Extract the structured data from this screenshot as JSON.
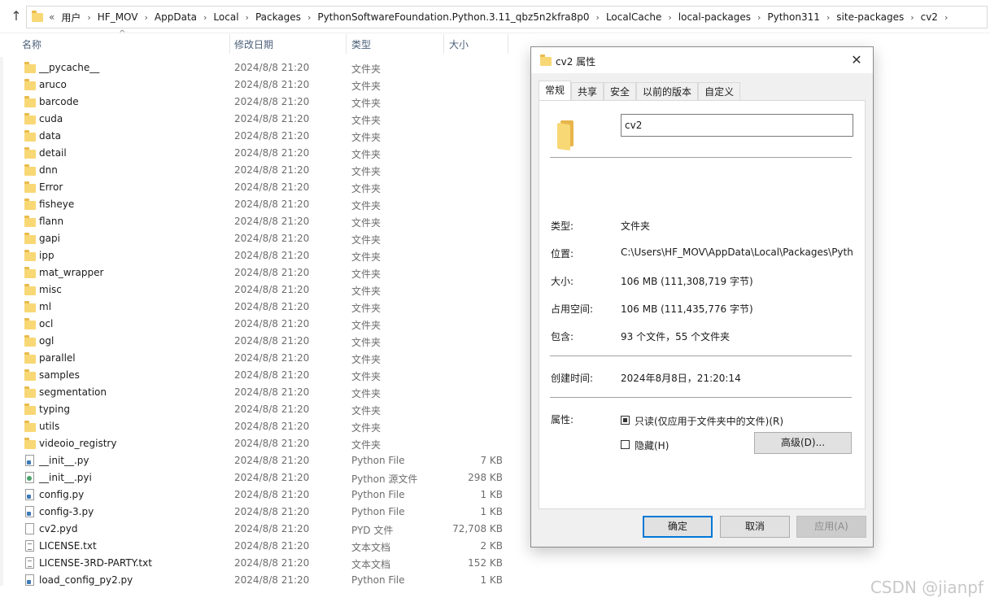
{
  "address_bar": {
    "overflow": "«",
    "crumbs": [
      "用户",
      "HF_MOV",
      "AppData",
      "Local",
      "Packages",
      "PythonSoftwareFoundation.Python.3.11_qbz5n2kfra8p0",
      "LocalCache",
      "local-packages",
      "Python311",
      "site-packages",
      "cv2"
    ]
  },
  "columns": {
    "name": "名称",
    "modified": "修改日期",
    "type": "类型",
    "size": "大小"
  },
  "files": [
    {
      "name": "__pycache__",
      "date": "2024/8/8 21:20",
      "type": "文件夹",
      "size": "",
      "icon": "folder"
    },
    {
      "name": "aruco",
      "date": "2024/8/8 21:20",
      "type": "文件夹",
      "size": "",
      "icon": "folder"
    },
    {
      "name": "barcode",
      "date": "2024/8/8 21:20",
      "type": "文件夹",
      "size": "",
      "icon": "folder"
    },
    {
      "name": "cuda",
      "date": "2024/8/8 21:20",
      "type": "文件夹",
      "size": "",
      "icon": "folder"
    },
    {
      "name": "data",
      "date": "2024/8/8 21:20",
      "type": "文件夹",
      "size": "",
      "icon": "folder"
    },
    {
      "name": "detail",
      "date": "2024/8/8 21:20",
      "type": "文件夹",
      "size": "",
      "icon": "folder"
    },
    {
      "name": "dnn",
      "date": "2024/8/8 21:20",
      "type": "文件夹",
      "size": "",
      "icon": "folder"
    },
    {
      "name": "Error",
      "date": "2024/8/8 21:20",
      "type": "文件夹",
      "size": "",
      "icon": "folder"
    },
    {
      "name": "fisheye",
      "date": "2024/8/8 21:20",
      "type": "文件夹",
      "size": "",
      "icon": "folder"
    },
    {
      "name": "flann",
      "date": "2024/8/8 21:20",
      "type": "文件夹",
      "size": "",
      "icon": "folder"
    },
    {
      "name": "gapi",
      "date": "2024/8/8 21:20",
      "type": "文件夹",
      "size": "",
      "icon": "folder"
    },
    {
      "name": "ipp",
      "date": "2024/8/8 21:20",
      "type": "文件夹",
      "size": "",
      "icon": "folder"
    },
    {
      "name": "mat_wrapper",
      "date": "2024/8/8 21:20",
      "type": "文件夹",
      "size": "",
      "icon": "folder"
    },
    {
      "name": "misc",
      "date": "2024/8/8 21:20",
      "type": "文件夹",
      "size": "",
      "icon": "folder"
    },
    {
      "name": "ml",
      "date": "2024/8/8 21:20",
      "type": "文件夹",
      "size": "",
      "icon": "folder"
    },
    {
      "name": "ocl",
      "date": "2024/8/8 21:20",
      "type": "文件夹",
      "size": "",
      "icon": "folder"
    },
    {
      "name": "ogl",
      "date": "2024/8/8 21:20",
      "type": "文件夹",
      "size": "",
      "icon": "folder"
    },
    {
      "name": "parallel",
      "date": "2024/8/8 21:20",
      "type": "文件夹",
      "size": "",
      "icon": "folder"
    },
    {
      "name": "samples",
      "date": "2024/8/8 21:20",
      "type": "文件夹",
      "size": "",
      "icon": "folder"
    },
    {
      "name": "segmentation",
      "date": "2024/8/8 21:20",
      "type": "文件夹",
      "size": "",
      "icon": "folder"
    },
    {
      "name": "typing",
      "date": "2024/8/8 21:20",
      "type": "文件夹",
      "size": "",
      "icon": "folder"
    },
    {
      "name": "utils",
      "date": "2024/8/8 21:20",
      "type": "文件夹",
      "size": "",
      "icon": "folder"
    },
    {
      "name": "videoio_registry",
      "date": "2024/8/8 21:20",
      "type": "文件夹",
      "size": "",
      "icon": "folder"
    },
    {
      "name": "__init__.py",
      "date": "2024/8/8 21:20",
      "type": "Python File",
      "size": "7 KB",
      "icon": "py"
    },
    {
      "name": "__init__.pyi",
      "date": "2024/8/8 21:20",
      "type": "Python 源文件",
      "size": "298 KB",
      "icon": "pyi"
    },
    {
      "name": "config.py",
      "date": "2024/8/8 21:20",
      "type": "Python File",
      "size": "1 KB",
      "icon": "py"
    },
    {
      "name": "config-3.py",
      "date": "2024/8/8 21:20",
      "type": "Python File",
      "size": "1 KB",
      "icon": "py"
    },
    {
      "name": "cv2.pyd",
      "date": "2024/8/8 21:20",
      "type": "PYD 文件",
      "size": "72,708 KB",
      "icon": "file"
    },
    {
      "name": "LICENSE.txt",
      "date": "2024/8/8 21:20",
      "type": "文本文档",
      "size": "2 KB",
      "icon": "txt"
    },
    {
      "name": "LICENSE-3RD-PARTY.txt",
      "date": "2024/8/8 21:20",
      "type": "文本文档",
      "size": "152 KB",
      "icon": "txt"
    },
    {
      "name": "load_config_py2.py",
      "date": "2024/8/8 21:20",
      "type": "Python File",
      "size": "1 KB",
      "icon": "py"
    }
  ],
  "dialog": {
    "title": "cv2 属性",
    "tabs": [
      "常规",
      "共享",
      "安全",
      "以前的版本",
      "自定义"
    ],
    "folder_name": "cv2",
    "props": {
      "type_label": "类型:",
      "type_value": "文件夹",
      "location_label": "位置:",
      "location_value": "C:\\Users\\HF_MOV\\AppData\\Local\\Packages\\Pytho",
      "size_label": "大小:",
      "size_value": "106 MB (111,308,719 字节)",
      "disk_label": "占用空间:",
      "disk_value": "106 MB (111,435,776 字节)",
      "contains_label": "包含:",
      "contains_value": "93 个文件，55 个文件夹",
      "created_label": "创建时间:",
      "created_value": "2024年8月8日，21:20:14",
      "attrs_label": "属性:",
      "readonly_label": "只读(仅应用于文件夹中的文件)(R)",
      "hidden_label": "隐藏(H)",
      "advanced_label": "高级(D)..."
    },
    "buttons": {
      "ok": "确定",
      "cancel": "取消",
      "apply": "应用(A)"
    }
  },
  "watermark": "CSDN @jianpf"
}
